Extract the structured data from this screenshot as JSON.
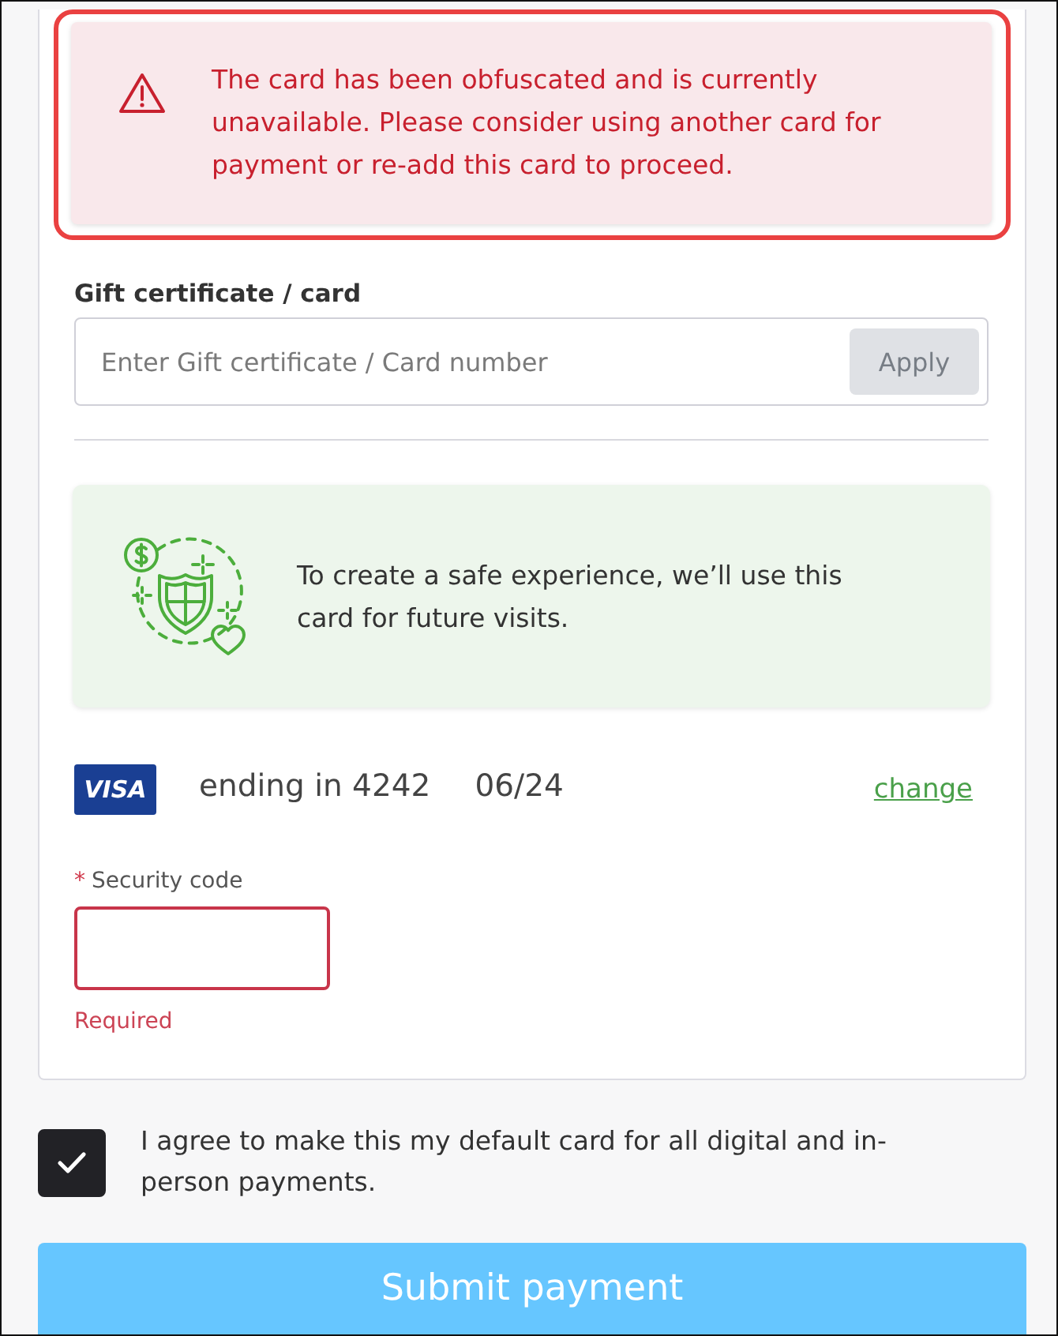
{
  "alert": {
    "kind": "error",
    "highlighted": true,
    "message": "The card has been obfuscated and is currently unavailable. Please consider using another card for payment or re-add this card to proceed."
  },
  "gift_card": {
    "label": "Gift certificate / card",
    "placeholder": "Enter Gift certificate / Card number",
    "apply_button": {
      "label": "Apply",
      "disabled": true
    }
  },
  "info_banner": {
    "message": "To create a safe experience, we’ll use this card for future visits."
  },
  "saved_card": {
    "brand_logo": "VISA",
    "ending": "ending in 4242",
    "expiry": "06/24",
    "change_link": "change"
  },
  "security_code": {
    "required_mark": "*",
    "label": "Security code",
    "invalid": true,
    "error": "Required"
  },
  "agreement": {
    "checked": true,
    "label": "I agree to make this my default card for all digital and in-person payments."
  },
  "submit_button": {
    "label": "Submit payment",
    "disabled": true
  }
}
